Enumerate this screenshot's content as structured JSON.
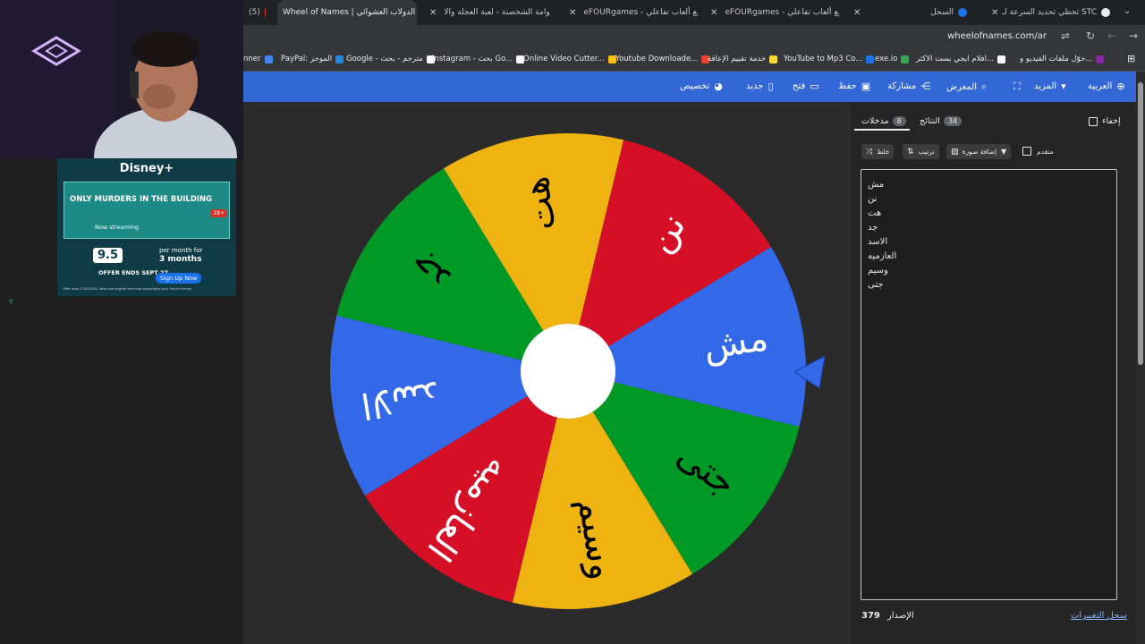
{
  "tabs": [
    {
      "label": "(5)",
      "icon": "youtube-icon",
      "active": false
    },
    {
      "label": "Wheel of Names | الدولاب العشوائي",
      "icon": "wheel-icon",
      "active": true
    },
    {
      "label": "دوامة الشخصنة - لعبة العجلة والا",
      "icon": "globe-icon",
      "active": false
    },
    {
      "label": "eFOURgames - مع ألعاب تفاعلي",
      "icon": "globe-icon",
      "active": false
    },
    {
      "label": "eFOURgames - مع ألعاب تفاعلي",
      "icon": "globe-icon",
      "active": false
    },
    {
      "label": "السجل",
      "icon": "history-icon",
      "active": false
    },
    {
      "label": "تحطي تحديد السرعة لـ STC",
      "icon": "globe-icon",
      "active": false
    }
  ],
  "url": "wheelofnames.com/ar",
  "bookmarks": [
    {
      "label": "nner",
      "color": "#4285f4"
    },
    {
      "label": "PayPal: الموجز",
      "color": "#1e88e5"
    },
    {
      "label": "Google - مترجم - بحث",
      "color": "#ffffff"
    },
    {
      "label": "instagram - بحث Go...",
      "color": "#ffffff"
    },
    {
      "label": "Online Video Cutter...",
      "color": "#fbbc04"
    },
    {
      "label": "Youtube Downloade...",
      "color": "#ea4335"
    },
    {
      "label": "خدمة تقييم الإعاقة",
      "color": "#fdd835"
    },
    {
      "label": "YouTube to Mp3 Co...",
      "color": "#1a73e8"
    },
    {
      "label": "exe.io",
      "color": "#34a853"
    },
    {
      "label": "افلام ايجي بست الاكثر...",
      "color": "#ffffff"
    },
    {
      "label": "حوّل ملفات الفيديو و...",
      "color": "#8e24aa"
    }
  ],
  "appbar": {
    "language": "العربية",
    "more": "المزيد",
    "gallery": "المعرض",
    "share": "مشاركة",
    "save": "حفظ",
    "open": "فتح",
    "new": "جديد",
    "customize": "تخصيص"
  },
  "panel": {
    "hide_label": "إخفاء",
    "results_label": "النتائج",
    "results_count": "34",
    "entries_label": "مدخلات",
    "entries_count": "8",
    "shuffle_label": "خلط",
    "sort_label": "ترتيب",
    "add_image_label": "إضافة صورة",
    "advanced_label": "متقدم",
    "entries": [
      "مش",
      "نن",
      "هت",
      "جد",
      "الاسد",
      "العازميه",
      "وسيم",
      "جتى"
    ],
    "version_label": "الإصدار",
    "version_number": "379",
    "changelog_label": "سجل التغييرات"
  },
  "wheel": {
    "segments": [
      {
        "label": "مش",
        "color": "#3369e8",
        "text_color": "#ffffff"
      },
      {
        "label": "جتى",
        "color": "#009925",
        "text_color": "#000000"
      },
      {
        "label": "وسيم",
        "color": "#eeb211",
        "text_color": "#000000"
      },
      {
        "label": "العازميه",
        "color": "#d50f25",
        "text_color": "#ffffff"
      },
      {
        "label": "الاسد",
        "color": "#3369e8",
        "text_color": "#ffffff"
      },
      {
        "label": "جد",
        "color": "#009925",
        "text_color": "#000000"
      },
      {
        "label": "هت",
        "color": "#eeb211",
        "text_color": "#000000"
      },
      {
        "label": "نن",
        "color": "#d50f25",
        "text_color": "#ffffff"
      }
    ],
    "pointer_color": "#3369e8"
  },
  "ad": {
    "brand": "Disney+",
    "show": "ONLY MURDERS IN THE BUILDING",
    "rating": "18+",
    "sub": "Now streaming",
    "price": "9.5",
    "per_month": "per month for",
    "months": "3 months",
    "offer": "OFFER ENDS SEPT 27",
    "signup": "Sign Up Now",
    "fine": "Offer ends 27/09/2024. New and eligible returning subscribers only. See full terms."
  }
}
